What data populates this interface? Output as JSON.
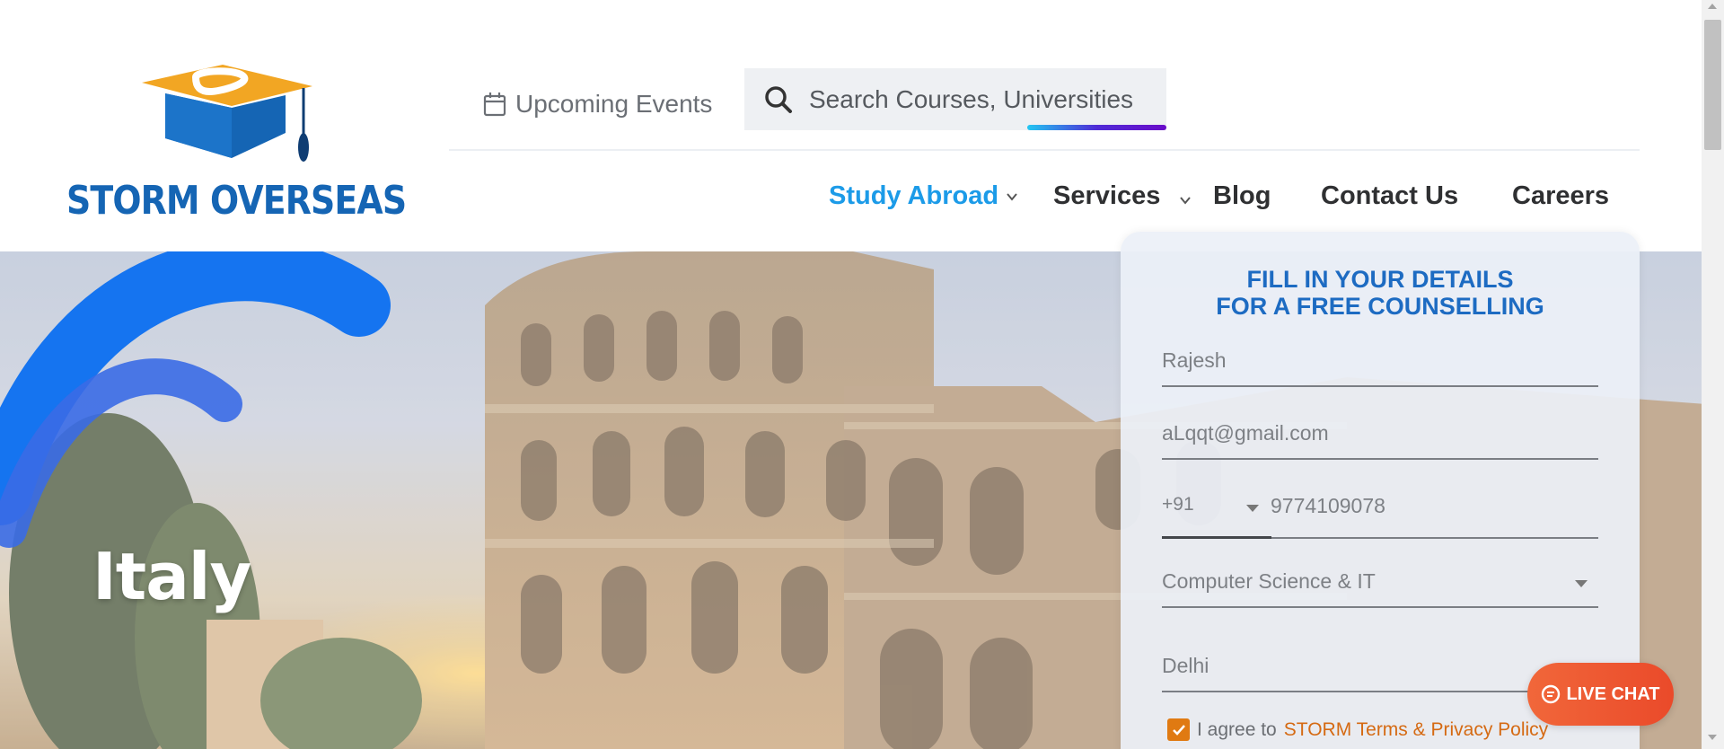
{
  "brand": {
    "name": "STORM OVERSEAS",
    "primary_color": "#1565b4",
    "accent_color": "#f2a623"
  },
  "header": {
    "events_label": "Upcoming Events",
    "events_icon": "calendar-icon",
    "search": {
      "placeholder": "Search Courses, Universities",
      "icon": "search-icon"
    }
  },
  "nav": {
    "items": [
      {
        "label": "Study Abroad",
        "active": true,
        "has_dropdown": true
      },
      {
        "label": "Services",
        "active": false,
        "has_dropdown": true
      },
      {
        "label": "Blog",
        "active": false,
        "has_dropdown": false
      },
      {
        "label": "Contact Us",
        "active": false,
        "has_dropdown": false
      },
      {
        "label": "Careers",
        "active": false,
        "has_dropdown": false
      }
    ],
    "active_color": "#1c9be8"
  },
  "hero": {
    "title": "Italy"
  },
  "form": {
    "title_line1": "FILL IN YOUR DETAILS",
    "title_line2": "FOR A FREE COUNSELLING",
    "name_value": "Rajesh",
    "email_value": "aLqqt@gmail.com",
    "phone_code": "+91",
    "phone_value": "9774109078",
    "course_value": "Computer Science & IT",
    "city_value": "Delhi",
    "agree_checked": true,
    "agree_text": "I agree to ",
    "agree_link": "STORM Terms & Privacy Policy"
  },
  "live_chat": {
    "label": "LIVE CHAT",
    "icon": "chat-bubble-icon",
    "color": "#ee5a31"
  }
}
